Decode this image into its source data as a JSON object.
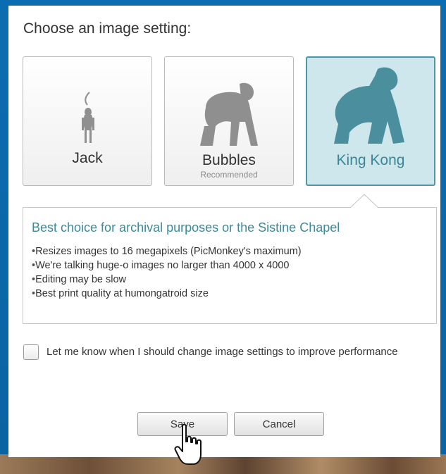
{
  "dialog": {
    "heading": "Choose an image setting:"
  },
  "options": [
    {
      "label": "Jack",
      "sublabel": "",
      "icon": "monkey-icon",
      "selected": false
    },
    {
      "label": "Bubbles",
      "sublabel": "Recommended",
      "icon": "chimpanzee-icon",
      "selected": false
    },
    {
      "label": "King Kong",
      "sublabel": "",
      "icon": "gorilla-icon",
      "selected": true
    }
  ],
  "description": {
    "title": "Best choice for archival purposes or the Sistine Chapel",
    "bullets": [
      "Resizes images to 16 megapixels (PicMonkey's maximum)",
      "We're talking huge-o images no larger than 4000 x 4000",
      "Editing may be slow",
      "Best print quality at humongatroid size"
    ]
  },
  "notify_checkbox": {
    "checked": false,
    "label": "Let me know when I should change image settings to improve performance"
  },
  "buttons": {
    "save": "Save",
    "cancel": "Cancel"
  },
  "colors": {
    "frame": "#0b6db1",
    "selected_bg": "#cde7ec",
    "selected_border": "#4e97a6",
    "accent_text": "#3d8a9b",
    "silhouette_gray": "#8f8f8f",
    "silhouette_teal": "#4b8e9d"
  }
}
